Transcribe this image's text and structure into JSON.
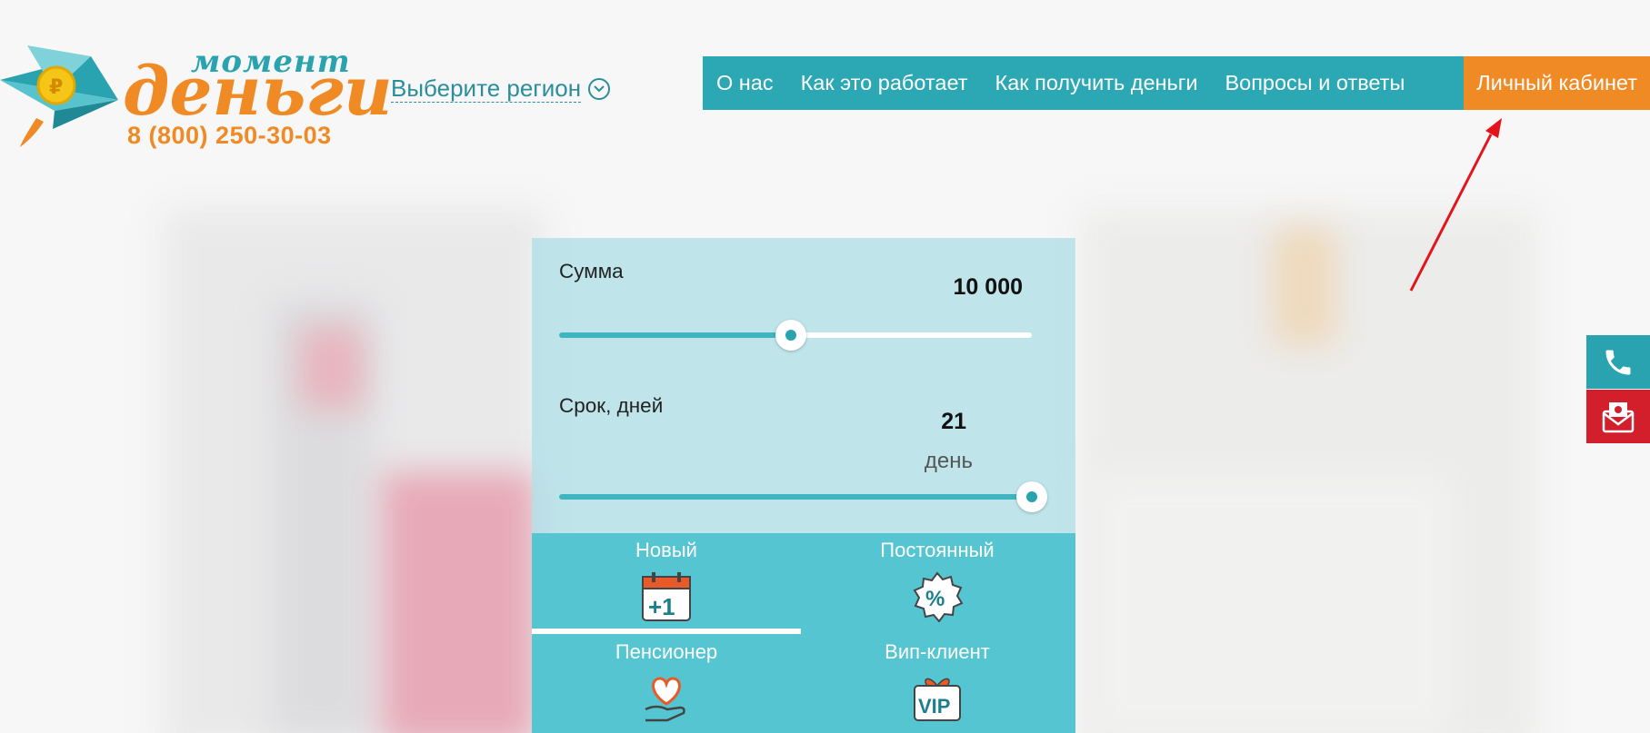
{
  "brand": {
    "word_top": "момент",
    "word_main": "деньги",
    "phone": "8 (800) 250-30-03"
  },
  "region": {
    "label": "Выберите регион"
  },
  "nav": {
    "items": [
      {
        "label": "О нас"
      },
      {
        "label": "Как это работает"
      },
      {
        "label": "Как получить деньги"
      },
      {
        "label": "Вопросы и ответы"
      }
    ],
    "cabinet_label": "Личный кабинет",
    "cabinet_color": "#f08a24",
    "nav_color": "#2ca8b5"
  },
  "calculator": {
    "sum": {
      "label": "Сумма",
      "value": "10 000",
      "fraction": 0.49
    },
    "term": {
      "label": "Срок, дней",
      "value": "21",
      "unit": "день",
      "fraction": 1.0
    },
    "client_types": [
      {
        "label": "Новый",
        "icon": "calendar-plus-one-icon",
        "active": true
      },
      {
        "label": "Постоянный",
        "icon": "percent-badge-icon",
        "active": false
      },
      {
        "label": "Пенсионер",
        "icon": "heart-hand-icon",
        "active": false
      },
      {
        "label": "Вип-клиент",
        "icon": "vip-gift-icon",
        "active": false
      }
    ]
  },
  "side_widgets": [
    {
      "icon": "phone-icon",
      "color": "#2aa3b0"
    },
    {
      "icon": "mail-icon",
      "color": "#d21f2b"
    }
  ]
}
